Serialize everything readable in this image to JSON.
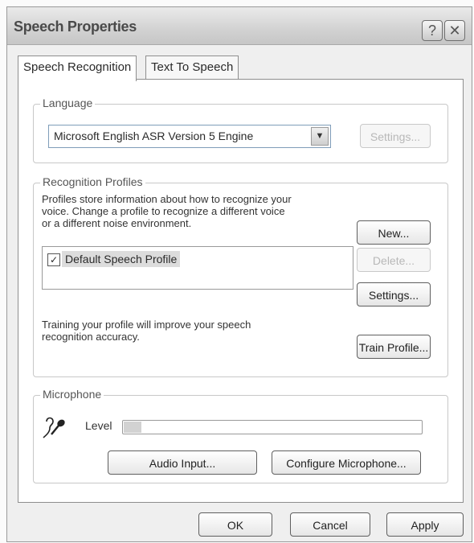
{
  "window": {
    "title": "Speech Properties",
    "help_glyph": "?",
    "close_glyph": "✕"
  },
  "tabs": [
    {
      "label": "Speech Recognition",
      "active": true
    },
    {
      "label": "Text To Speech",
      "active": false
    }
  ],
  "language": {
    "group_label": "Language",
    "engine_value": "Microsoft English ASR Version 5 Engine",
    "settings_label": "Settings..."
  },
  "profiles": {
    "group_label": "Recognition Profiles",
    "description_lines": [
      "Profiles store information about how to recognize your",
      "voice. Change a profile to recognize a different voice",
      "or a different noise environment."
    ],
    "list_items": [
      {
        "label": "Default Speech Profile",
        "checked": true
      }
    ],
    "new_label": "New...",
    "delete_label": "Delete...",
    "settings_label": "Settings...",
    "training_lines": [
      "Training your profile will improve your speech",
      "recognition accuracy."
    ],
    "train_label": "Train Profile..."
  },
  "microphone": {
    "group_label": "Microphone",
    "level_label": "Level",
    "level_fraction": 0.06,
    "audio_input_label": "Audio Input...",
    "configure_label": "Configure Microphone..."
  },
  "footer": {
    "ok_label": "OK",
    "cancel_label": "Cancel",
    "apply_label": "Apply"
  },
  "colors": {
    "dialog_bg": "#efefef",
    "panel_bg": "#ffffff",
    "selection": "#dcdcdc"
  },
  "icons": {
    "microphone": "microphone-icon",
    "dropdown": "chevron-down-icon",
    "help": "help-icon",
    "close": "close-icon",
    "check": "checkmark-icon"
  }
}
